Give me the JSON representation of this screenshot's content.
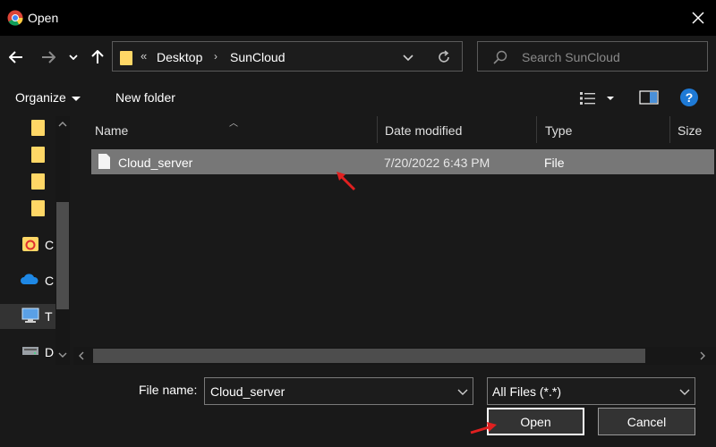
{
  "window": {
    "title": "Open",
    "icon": "chrome-icon"
  },
  "nav": {
    "back_icon": "back-arrow-icon",
    "forward_icon": "forward-arrow-icon",
    "recent_icon": "chevron-down-icon",
    "up_icon": "up-arrow-icon"
  },
  "address": {
    "overflow": "«",
    "crumbs": [
      "Desktop",
      "SunCloud"
    ],
    "separator": "›"
  },
  "search": {
    "placeholder": "Search SunCloud"
  },
  "toolbar": {
    "organize": "Organize",
    "new_folder": "New folder",
    "help": "?"
  },
  "sidebar": {
    "items": [
      {
        "label": "",
        "icon": "folder-icon"
      },
      {
        "label": "",
        "icon": "folder-icon"
      },
      {
        "label": "",
        "icon": "folder-icon"
      },
      {
        "label": "",
        "icon": "folder-icon"
      },
      {
        "label": "C",
        "icon": "creative-cloud-icon"
      },
      {
        "label": "C",
        "icon": "onedrive-icon"
      },
      {
        "label": "T",
        "icon": "this-pc-icon"
      },
      {
        "label": "D",
        "icon": "drive-icon"
      }
    ]
  },
  "columns": [
    "Name",
    "Date modified",
    "Type",
    "Size"
  ],
  "files": [
    {
      "name": "Cloud_server",
      "date": "7/20/2022 6:43 PM",
      "type": "File",
      "size": ""
    }
  ],
  "footer": {
    "file_name_label": "File name:",
    "file_name_value": "Cloud_server",
    "file_type": "All Files (*.*)",
    "open": "Open",
    "cancel": "Cancel"
  },
  "colors": {
    "accent": "#1e7ad6",
    "selection": "#777777",
    "annotation": "#e02020",
    "folder": "#ffd766"
  }
}
